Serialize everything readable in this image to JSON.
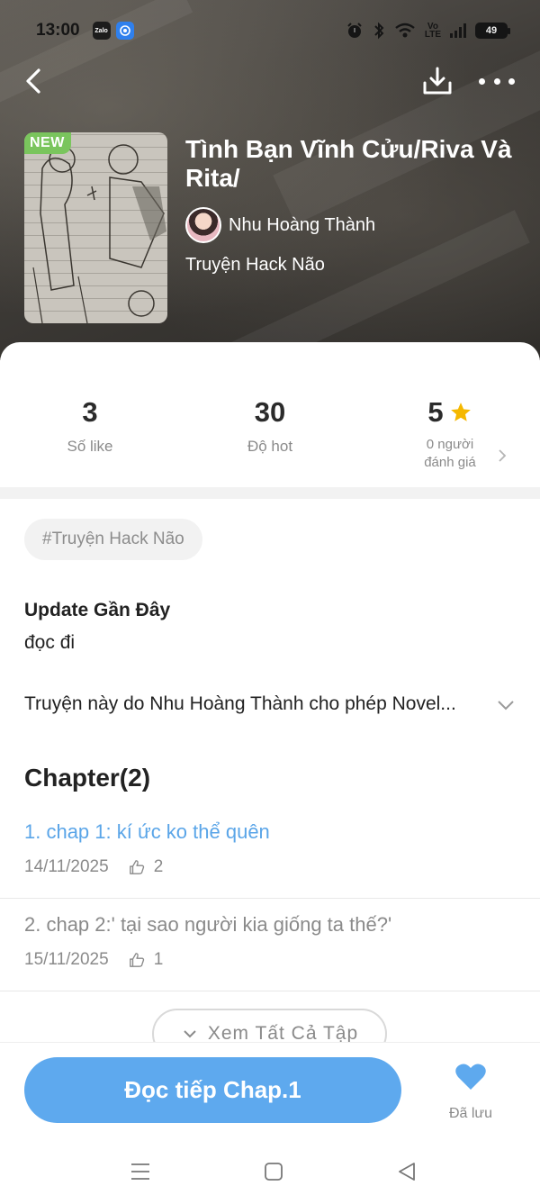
{
  "status_bar": {
    "time": "13:00",
    "apps": [
      "Zalo",
      "Messenger"
    ],
    "network": "Vo LTE",
    "battery": "49"
  },
  "header": {
    "back_icon": "chevron-left-icon",
    "download_icon": "download-icon",
    "more_icon": "more-horizontal-icon"
  },
  "story": {
    "badge": "NEW",
    "title": "Tình Bạn Vĩnh Cửu/Riva Và Rita/",
    "author": "Nhu Hoàng Thành",
    "category": "Truyện Hack Não"
  },
  "stats": [
    {
      "value": "3",
      "label": "Số like"
    },
    {
      "value": "30",
      "label": "Độ hot"
    },
    {
      "value": "5",
      "label_line1": "0 người",
      "label_line2": "đánh giá"
    }
  ],
  "tag": "#Truyện Hack Não",
  "update": {
    "title": "Update Gần Đây",
    "body": "đọc đi"
  },
  "description": "Truyện này do Nhu Hoàng Thành cho phép Novel...",
  "chapters": {
    "title": "Chapter(2)",
    "items": [
      {
        "name": "1. chap 1: kí ức ko thể quên",
        "date": "14/11/2025",
        "likes": "2"
      },
      {
        "name": "2. chap 2:' tại sao người kia giống ta thế?'",
        "date": "15/11/2025",
        "likes": "1"
      }
    ],
    "see_all": "Xem Tất Cả Tập"
  },
  "bottom": {
    "read_button": "Đọc tiếp Chap.1",
    "saved_label": "Đã lưu"
  },
  "colors": {
    "accent": "#5ea9ee",
    "link": "#5aa5e8",
    "badge": "#7ac55d",
    "star": "#f5b800"
  }
}
